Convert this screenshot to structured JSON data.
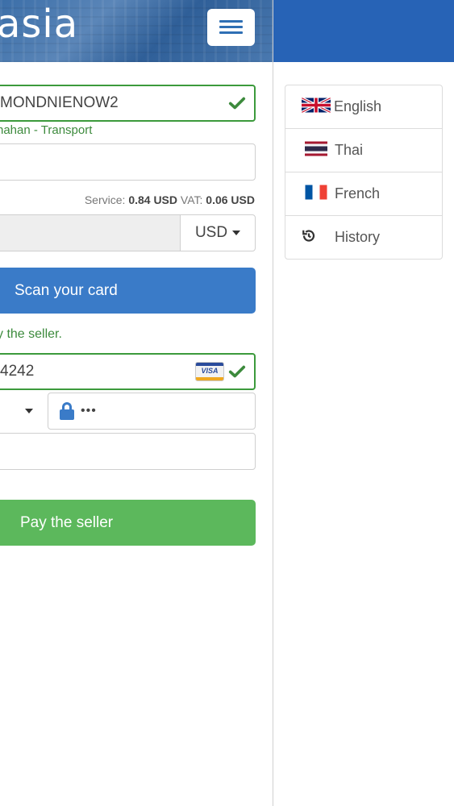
{
  "header": {
    "brand": "asia"
  },
  "form": {
    "seller_code": "MONDNIENOW2",
    "seller_hint": "nahan - Transport",
    "fees": {
      "service_label": "Service:",
      "service_value": "0.84 USD",
      "vat_label": "VAT:",
      "vat_value": "0.06 USD"
    },
    "currency": "USD",
    "scan_button": "Scan your card",
    "info_text": "y the seller.",
    "card_number": "4242",
    "card_brand_label": "VISA",
    "cvv_masked": "•••",
    "pay_button": "Pay the seller"
  },
  "side_menu": {
    "items": [
      {
        "label": "English",
        "icon": "uk-flag-icon"
      },
      {
        "label": "Thai",
        "icon": "thai-flag-icon"
      },
      {
        "label": "French",
        "icon": "french-flag-icon"
      },
      {
        "label": "History",
        "icon": "history-icon"
      }
    ]
  },
  "colors": {
    "primary": "#3a7bc8",
    "success": "#5cb85c",
    "header": "#2763b6",
    "valid_border": "#3c9a3c"
  }
}
